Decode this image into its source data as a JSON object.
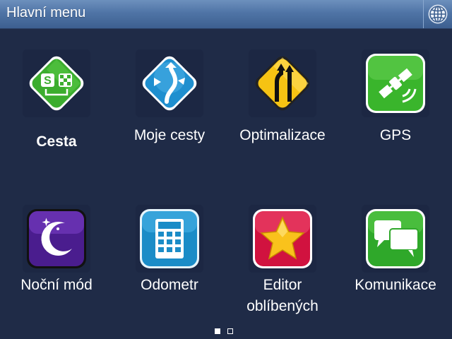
{
  "header": {
    "title": "Hlavní menu",
    "language_icon": "globe-icon"
  },
  "menu": [
    {
      "label": "Cesta",
      "icon": "route-icon",
      "selected": true
    },
    {
      "label": "Moje cesty",
      "icon": "my-routes-icon"
    },
    {
      "label": "Optimalizace",
      "icon": "road-sign-icon"
    },
    {
      "label": "GPS",
      "icon": "satellite-icon"
    },
    {
      "label": "Noční mód",
      "icon": "moon-icon"
    },
    {
      "label": "Odometr",
      "icon": "calculator-icon"
    },
    {
      "label": "Editor",
      "label2": "oblíbených",
      "icon": "star-icon"
    },
    {
      "label": "Komunikace",
      "icon": "chat-icon"
    }
  ],
  "pager": {
    "current_page": 1,
    "pages": 2
  },
  "colors": {
    "background": "#1f2b47",
    "titlebar": "#4f74a6"
  }
}
